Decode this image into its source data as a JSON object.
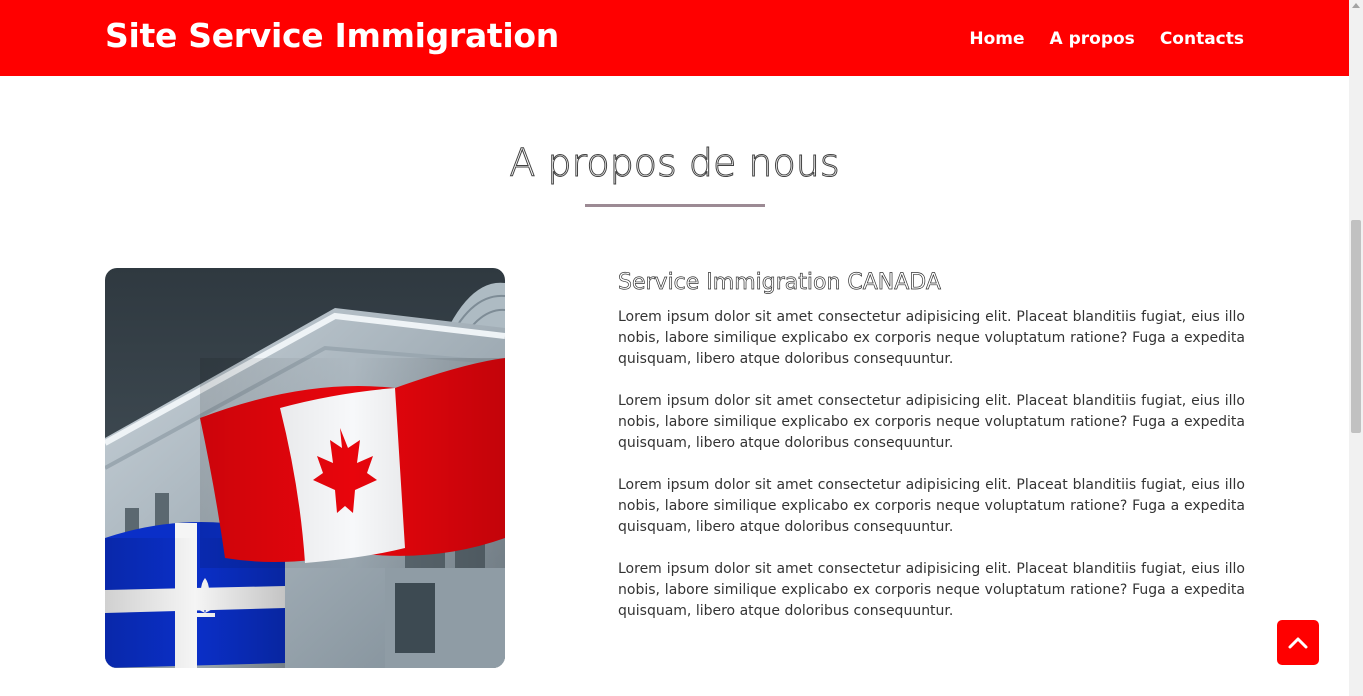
{
  "header": {
    "brand": "Site Service Immigration",
    "nav": [
      "Home",
      "A propos",
      "Contacts"
    ]
  },
  "section": {
    "title": "A propos de nous"
  },
  "about": {
    "image_alt": "Canadian and Quebec flags in front of a building",
    "heading": "Service Immigration CANADA",
    "paragraphs": [
      "Lorem ipsum dolor sit amet consectetur adipisicing elit. Placeat blanditiis fugiat, eius illo nobis, labore similique explicabo ex corporis neque voluptatum ratione? Fuga a expedita quisquam, libero atque doloribus consequuntur.",
      "Lorem ipsum dolor sit amet consectetur adipisicing elit. Placeat blanditiis fugiat, eius illo nobis, labore similique explicabo ex corporis neque voluptatum ratione? Fuga a expedita quisquam, libero atque doloribus consequuntur.",
      "Lorem ipsum dolor sit amet consectetur adipisicing elit. Placeat blanditiis fugiat, eius illo nobis, labore similique explicabo ex corporis neque voluptatum ratione? Fuga a expedita quisquam, libero atque doloribus consequuntur.",
      "Lorem ipsum dolor sit amet consectetur adipisicing elit. Placeat blanditiis fugiat, eius illo nobis, labore similique explicabo ex corporis neque voluptatum ratione? Fuga a expedita quisquam, libero atque doloribus consequuntur."
    ]
  },
  "back_to_top": {
    "icon": "chevron-up-icon"
  },
  "colors": {
    "primary": "#ff0000",
    "underline": "#9c8a94",
    "text": "#333333"
  }
}
